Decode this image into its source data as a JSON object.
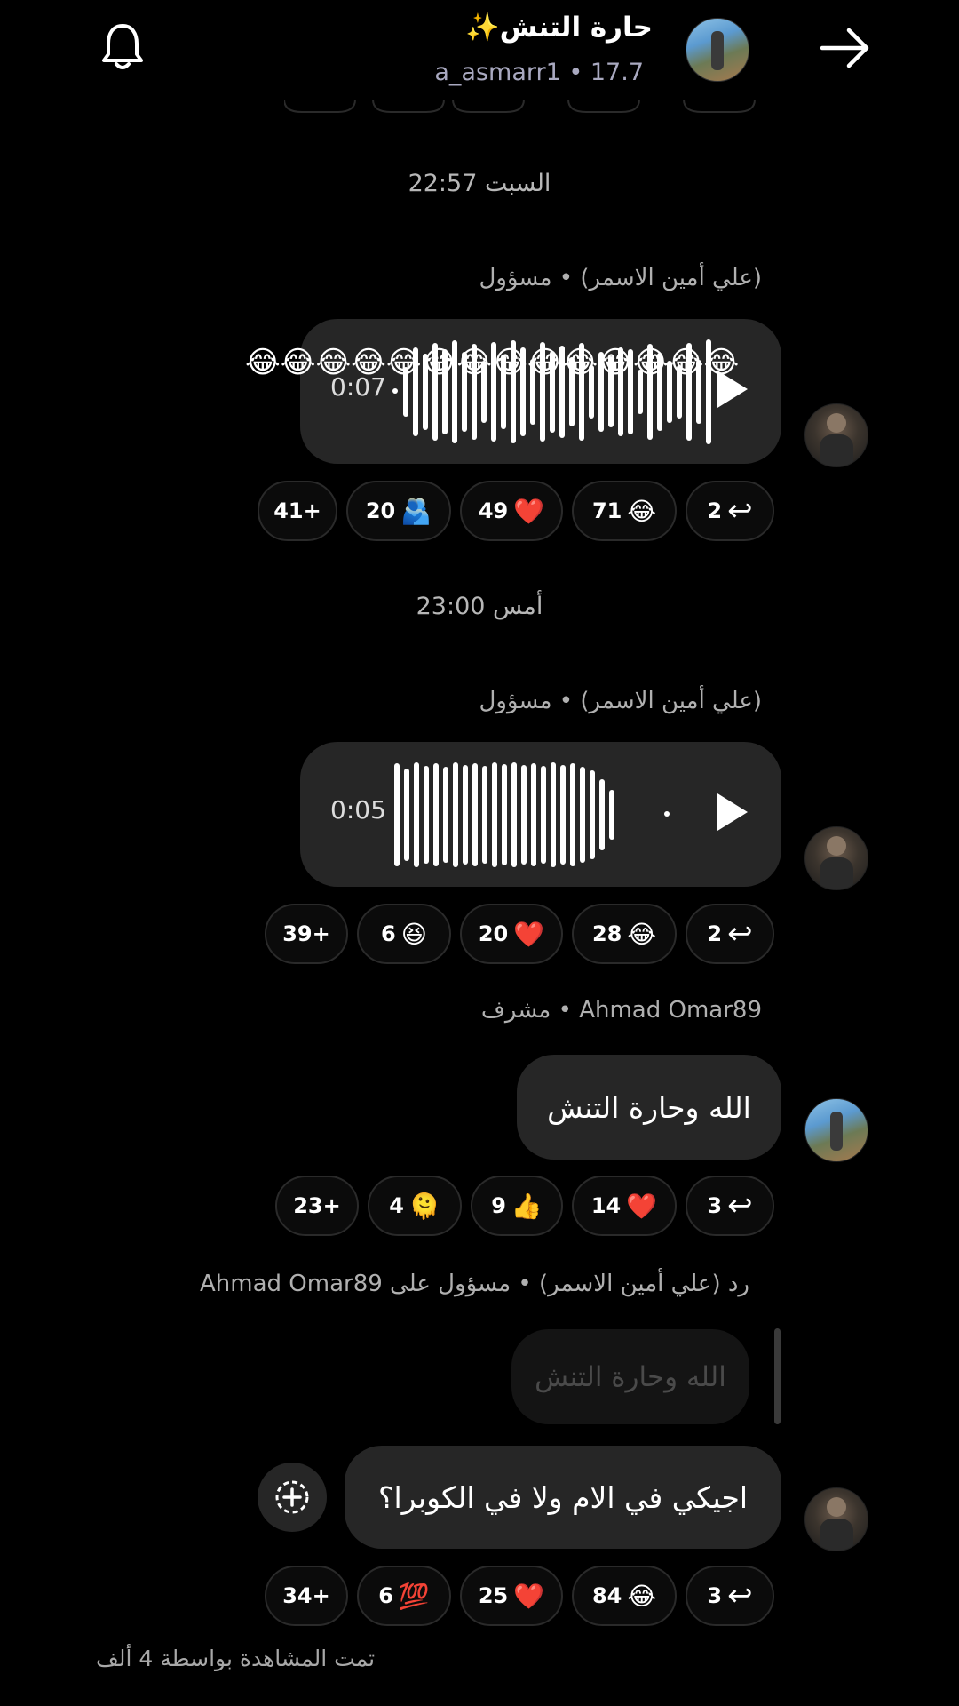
{
  "header": {
    "title": "حارة التنش✨",
    "subtitle": "a_asmarr1 • 17.7",
    "icons": [
      "bell-icon",
      "arrow-right-icon"
    ]
  },
  "timestamps": [
    "السبت 22:57",
    "أمس 23:00"
  ],
  "messages": [
    {
      "sender": "(علي أمين الاسمر) • مسؤول",
      "type": "voice",
      "duration": "0:07",
      "overlay_emoji": "😂😂😂😂😂😂😂😂😂😂😂😂😂😂",
      "reactions": [
        {
          "count": "2",
          "emoji": "reply"
        },
        {
          "count": "71",
          "emoji": "😂"
        },
        {
          "count": "49",
          "emoji": "❤️"
        },
        {
          "count": "20",
          "emoji": "🫂"
        },
        {
          "count": "41+",
          "emoji": ""
        }
      ]
    },
    {
      "sender": "(علي أمين الاسمر) • مسؤول",
      "type": "voice",
      "duration": "0:05",
      "reactions": [
        {
          "count": "2",
          "emoji": "reply"
        },
        {
          "count": "28",
          "emoji": "😂"
        },
        {
          "count": "20",
          "emoji": "❤️"
        },
        {
          "count": "6",
          "emoji": "😆"
        },
        {
          "count": "39+",
          "emoji": ""
        }
      ]
    },
    {
      "sender": "Ahmad Omar89 • مشرف",
      "type": "text",
      "text": "الله وحارة التنش",
      "reactions": [
        {
          "count": "3",
          "emoji": "reply"
        },
        {
          "count": "14",
          "emoji": "❤️"
        },
        {
          "count": "9",
          "emoji": "👍"
        },
        {
          "count": "4",
          "emoji": "🫠"
        },
        {
          "count": "23+",
          "emoji": ""
        }
      ]
    },
    {
      "sender": "رد (علي أمين الاسمر) • مسؤول على Ahmad Omar89",
      "type": "reply",
      "quoted": "الله وحارة التنش",
      "text": "اجيكي في الام ولا في الكوبرا؟",
      "reactions": [
        {
          "count": "3",
          "emoji": "reply"
        },
        {
          "count": "84",
          "emoji": "😂"
        },
        {
          "count": "25",
          "emoji": "❤️"
        },
        {
          "count": "6",
          "emoji": "💯"
        },
        {
          "count": "34+",
          "emoji": ""
        }
      ]
    }
  ],
  "footer": {
    "seen_text": "تمت المشاهدة بواسطة 4 ألف"
  }
}
